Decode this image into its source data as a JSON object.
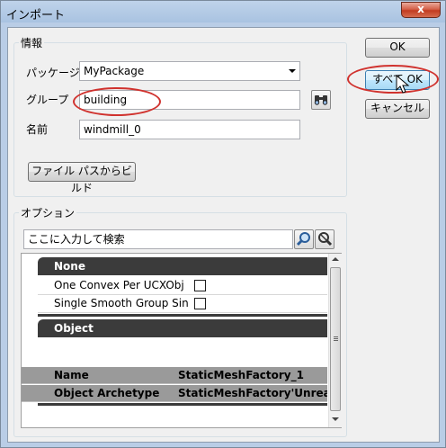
{
  "window": {
    "title": "インポート",
    "close_label": "x"
  },
  "info_group": {
    "legend": "情報",
    "package_label": "パッケージ",
    "package_value": "MyPackage",
    "group_label": "グループ",
    "group_value": "building",
    "name_label": "名前",
    "name_value": "windmill_0",
    "build_button": "ファイル パスからビルド"
  },
  "right_buttons": {
    "ok": "OK",
    "ok_all": "すべて OK",
    "cancel": "キャンセル"
  },
  "options_group": {
    "legend": "オプション",
    "search_placeholder": "ここに入力して検索"
  },
  "property_grid": {
    "categories": [
      {
        "name": "None",
        "properties": [
          {
            "name": "One Convex Per UCXObj",
            "checked": false
          },
          {
            "name": "Single Smooth Group Sin",
            "checked": false
          }
        ]
      },
      {
        "name": "Object",
        "properties": [
          {
            "name": "Name",
            "value": "StaticMeshFactory_1"
          },
          {
            "name": "Object Archetype",
            "value": "StaticMeshFactory'UnrealEd"
          }
        ]
      }
    ]
  },
  "colors": {
    "annotation_red": "#d0322e",
    "category_header": "#3b3b3b",
    "object_row": "#9a9a9a"
  },
  "icons": {
    "binoculars": "binoculars-icon",
    "search": "search-icon",
    "clear_search": "clear-search-icon",
    "cursor": "mouse-pointer-icon"
  }
}
